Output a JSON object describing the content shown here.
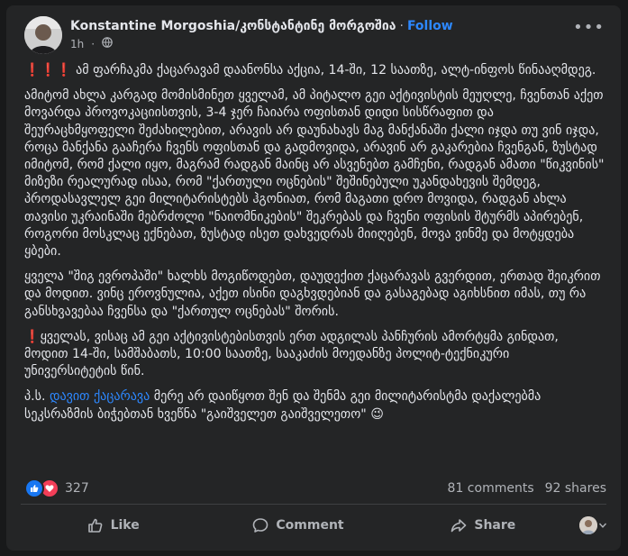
{
  "post": {
    "author": "Konstantine Morgoshia/კონსტანტინე მორგოშია",
    "separator": "·",
    "follow_label": "Follow",
    "time": "1h",
    "more_label": "•••",
    "paragraphs": {
      "p1_icons": "❗❗❗",
      "p1": "ამ ფარჩაკმა ქაცარავამ დაანონსა აქცია, 14-ში, 12 საათზე, ალტ-ინფოს წინააღმდეგ.",
      "p2": "ამიტომ ახლა კარგად მომისმინეთ ყველამ, ამ პიტალო გეი აქტივისტის მეუღლე, ჩვენთან აქეთ მოვარდა პროვოკაციისთვის, 3-4 ჯერ ჩაიარა ოფისთან დიდი სისწრაფით და შეურაცხმყოფელი შეძახილებით, არავის არ დაუნახავს მაგ მანქანაში ქალი იჯდა თუ ვინ იჯდა, როცა მანქანა გააჩერა ჩვენს ოფისთან და გადმოვიდა, არავინ არ გაკარებია ჩვენგან, ზუსტად იმიტომ, რომ ქალი იყო, მაგრამ რადგან მაინც არ ასვენებთ გამჩენი, რადგან ამათი \"წიკვინის\" მიზეზი რეალურად ისაა, რომ \"ქართული ოცნების\" შეშინებული უკანდახევის შემდეგ, პროდასავლელ გეი მილიტარისტებს ჰგონიათ, რომ მაგათი დრო მოვიდა, რადგან ახლა თავისი უკრაინაში მებრძოლი \"ნაიომნიკების\" შეკრებას და ჩვენი ოფისის შტურმს აპირებენ, როგორი მოსკლაც ექნებათ, ზუსტად ისეთ დახვედრას მიიღებენ, მოვა ვინმე და მოტყდება ყბები.",
      "p3": "ყველა \"შიგ ევროპაში\" ხალხს მოგიწოდებთ, დაუდექით ქაცარავას გვერდით, ერთად შეიკრით და მოდით. ვინც ეროვნულია, აქეთ ისინი დაგხვდებიან და გასაგებად აგიხსნით იმას, თუ რა განსხვავებაა ჩვენსა და \"ქართულ ოცნებას\" შორის.",
      "p4_icon": "❗",
      "p4": "ყველას, ვისაც ამ გეი აქტივისტებისთვის ერთ ადგილას პანჩურის ამორტყმა გინდათ, მოდით 14-ში, სამშაბათს, 10:00 საათზე, სააკაძის მოედანზე პოლიტ-ტექნიკური უნივერსიტეტის წინ.",
      "p5_prefix": "პ.ს.",
      "p5_link": "დავით ქაცარავა",
      "p5_rest": "მერე არ დაიწყოთ შენ და შენმა გეი მილიტარისტმა დაქალებმა სეკსრაზმის ბიჭებთან ხვეწნა \"გაიშველეთ გაიშველეთო\"",
      "p5_emoji": "😉"
    },
    "reactions": {
      "count": "327",
      "comments": "81 comments",
      "shares": "92 shares"
    },
    "actions": {
      "like": "Like",
      "comment": "Comment",
      "share": "Share"
    }
  },
  "colors": {
    "background": "#18191a",
    "card": "#242526",
    "text": "#e4e6eb",
    "secondary": "#b0b3b8",
    "link": "#2d88ff",
    "like_blue": "#1877f2",
    "love_red": "#f33e58"
  }
}
